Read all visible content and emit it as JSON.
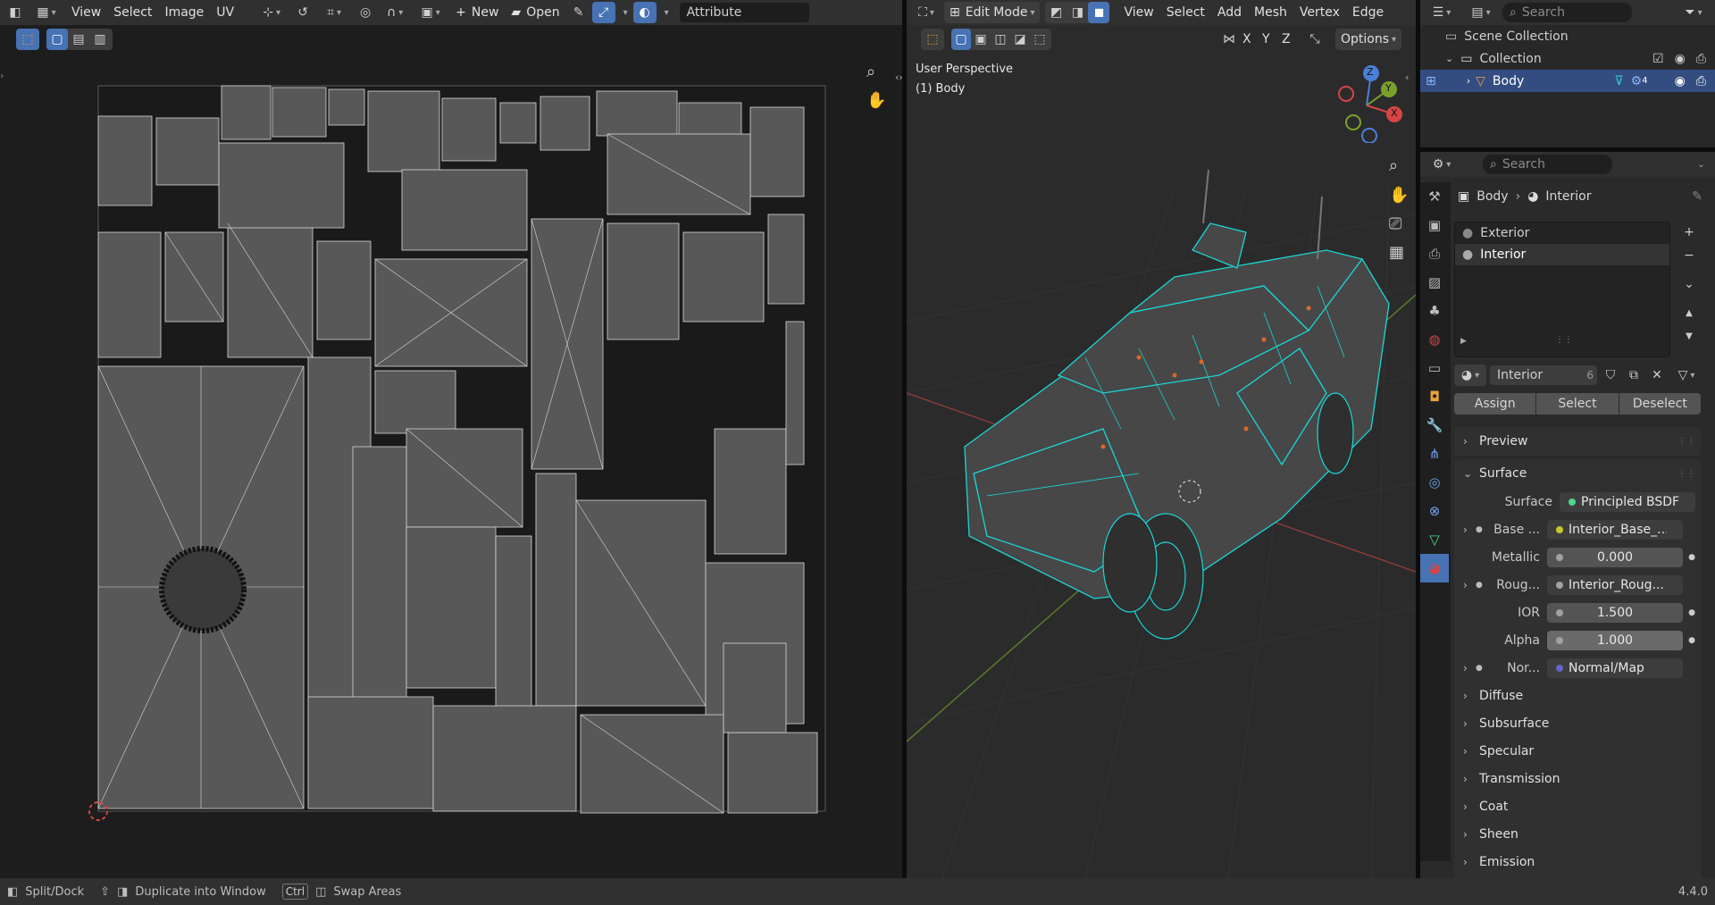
{
  "uv_header": {
    "menus": [
      "View",
      "Select",
      "Image",
      "UV"
    ],
    "new_label": "New",
    "open_label": "Open",
    "attribute_label": "Attribute"
  },
  "viewport_header": {
    "mode_label": "Edit Mode",
    "menus": [
      "View",
      "Select",
      "Add",
      "Mesh",
      "Vertex",
      "Edge"
    ],
    "axes": [
      "X",
      "Y",
      "Z"
    ],
    "options_label": "Options",
    "overlay_title": "User Perspective",
    "overlay_object": "(1) Body",
    "gizmo": {
      "z": "Z",
      "y": "Y",
      "x": "X"
    }
  },
  "outliner": {
    "search_placeholder": "Search",
    "scene_collection": "Scene Collection",
    "collection": "Collection",
    "object": "Body",
    "modifier_count": "4"
  },
  "properties": {
    "search_placeholder": "Search",
    "breadcrumb_object": "Body",
    "breadcrumb_material": "Interior",
    "slots": [
      "Exterior",
      "Interior"
    ],
    "material_name": "Interior",
    "material_users": "6",
    "assign_label": "Assign",
    "select_label": "Select",
    "deselect_label": "Deselect",
    "preview_label": "Preview",
    "surface_panel": "Surface",
    "surface_label": "Surface",
    "surface_value": "Principled BSDF",
    "rows": [
      {
        "label": "Base ...",
        "value": "Interior_Base_...",
        "dot": "#c7c729",
        "expand": true
      },
      {
        "label": "Metallic",
        "value": "0.000",
        "dot": "#a1a1a1",
        "expand": false
      },
      {
        "label": "Roug...",
        "value": "Interior_Roug...",
        "dot": "#a1a1a1",
        "expand": true
      },
      {
        "label": "IOR",
        "value": "1.500",
        "dot": "#a1a1a1",
        "expand": false
      },
      {
        "label": "Alpha",
        "value": "1.000",
        "dot": "#a1a1a1",
        "expand": false
      },
      {
        "label": "Nor...",
        "value": "Normal/Map",
        "dot": "#6363c7",
        "expand": true
      }
    ],
    "subpanels": [
      "Diffuse",
      "Subsurface",
      "Specular",
      "Transmission",
      "Coat",
      "Sheen",
      "Emission"
    ]
  },
  "status_bar": {
    "split_dock": "Split/Dock",
    "duplicate": "Duplicate into Window",
    "ctrl_key": "Ctrl",
    "swap": "Swap Areas",
    "version": "4.4.0"
  },
  "colors": {
    "accent": "#4772b3",
    "wire_selected": "#1bd6d6",
    "uv_face": "#5a5a5a",
    "x_axis": "#c84a4a",
    "y_axis": "#6a9a2a"
  }
}
